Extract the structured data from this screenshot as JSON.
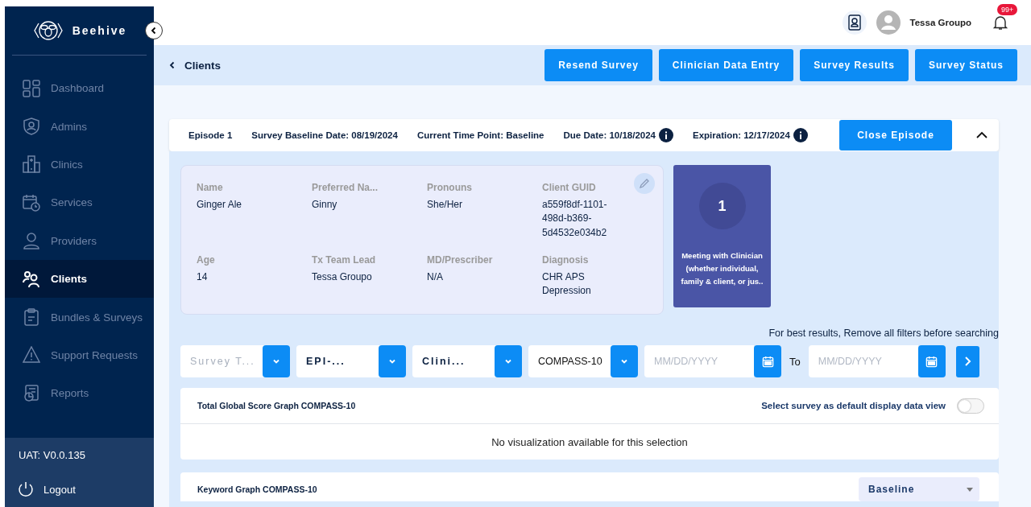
{
  "sidebar": {
    "logo": "Beehive",
    "items": [
      {
        "label": "Dashboard",
        "kind": "grid",
        "selected": false
      },
      {
        "label": "Admins",
        "kind": "shield",
        "selected": false
      },
      {
        "label": "Clinics",
        "kind": "building",
        "selected": false
      },
      {
        "label": "Services",
        "kind": "calendar",
        "selected": false
      },
      {
        "label": "Providers",
        "kind": "person",
        "selected": false
      },
      {
        "label": "Clients",
        "kind": "people",
        "selected": true
      },
      {
        "label": "Bundles & Surveys",
        "kind": "clipboard",
        "selected": false
      },
      {
        "label": "Support Requests",
        "kind": "warning",
        "selected": false
      },
      {
        "label": "Reports",
        "kind": "report",
        "selected": false
      }
    ],
    "version": "UAT: V0.0.135",
    "logout": "Logout"
  },
  "header": {
    "user_name": "Tessa Groupo",
    "notification_badge": "99+"
  },
  "breadcrumb": "Clients",
  "actions": [
    "Resend Survey",
    "Clinician Data Entry",
    "Survey Results",
    "Survey Status"
  ],
  "episode": {
    "fields": [
      {
        "text": "Episode 1",
        "info": false
      },
      {
        "text": "Survey Baseline Date: 08/19/2024",
        "info": false
      },
      {
        "text": "Current Time Point: Baseline",
        "info": false
      },
      {
        "text": "Due Date: 10/18/2024",
        "info": true
      },
      {
        "text": "Expiration: 12/17/2024",
        "info": true
      }
    ],
    "close_button": "Close Episode",
    "expanded": true
  },
  "client": {
    "fields": [
      {
        "label": "Name",
        "value": "Ginger Ale"
      },
      {
        "label": "Preferred Na...",
        "value": "Ginny"
      },
      {
        "label": "Pronouns",
        "value": "She/Her"
      },
      {
        "label": "Client GUID",
        "value": "a559f8df-1101-498d-b369-5d4532e034b2"
      },
      {
        "label": "Age",
        "value": "14"
      },
      {
        "label": "Tx Team Lead",
        "value": "Tessa Groupo"
      },
      {
        "label": "MD/Prescriber",
        "value": "N/A"
      },
      {
        "label": "Diagnosis",
        "value": "CHR APS Depression"
      }
    ]
  },
  "tile": {
    "number": "1",
    "text": "Meeting with Clinician (whether individual, family & client, or jus.."
  },
  "filter_hint": "For best results, Remove all filters before searching",
  "filters": [
    {
      "kind": "select",
      "placeholder": "Survey T..."
    },
    {
      "kind": "select",
      "value": "EPI-..."
    },
    {
      "kind": "select",
      "value": "Clini..."
    },
    {
      "kind": "select",
      "value": "COMPASS-10"
    },
    {
      "kind": "date",
      "placeholder": "MM/DD/YYYY"
    },
    {
      "kind": "label",
      "text": "To"
    },
    {
      "kind": "date",
      "placeholder": "MM/DD/YYYY"
    },
    {
      "kind": "go"
    }
  ],
  "graphs": [
    {
      "title": "Total Global Score Graph COMPASS-10",
      "toggle_label": "Select survey as default display data view",
      "toggle_on": false,
      "message": "No visualization available for this selection"
    },
    {
      "title": "Keyword Graph COMPASS-10",
      "dropdown": "Baseline"
    }
  ]
}
